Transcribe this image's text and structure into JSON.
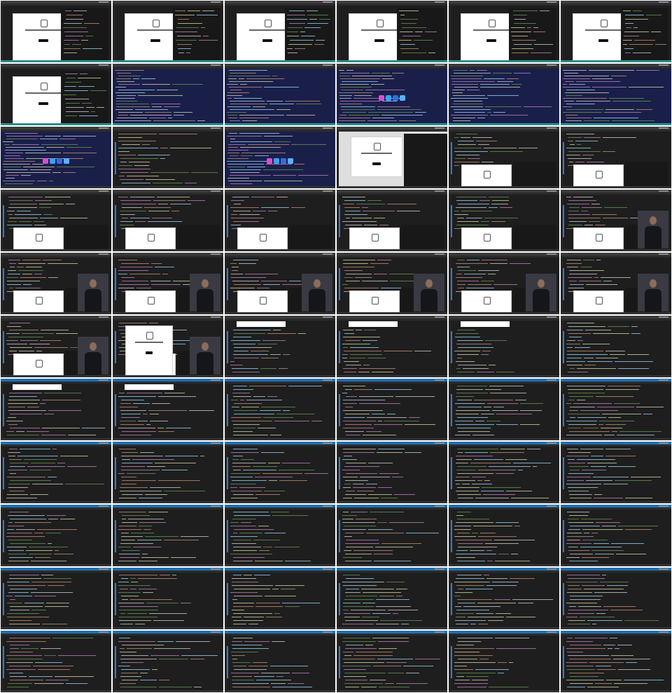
{
  "contact_sheet": {
    "columns": 6,
    "rows": 11,
    "frames": [
      {
        "variant": "dark-modal"
      },
      {
        "variant": "dark-modal"
      },
      {
        "variant": "dark-modal"
      },
      {
        "variant": "dark-modal"
      },
      {
        "variant": "dark-modal-panel"
      },
      {
        "variant": "dark-modal-panel"
      },
      {
        "variant": "dark-modal"
      },
      {
        "variant": "terminal-blue"
      },
      {
        "variant": "terminal-blue"
      },
      {
        "variant": "terminal-blue"
      },
      {
        "variant": "terminal-blue"
      },
      {
        "variant": "terminal-blue"
      },
      {
        "variant": "terminal-blue-dock"
      },
      {
        "variant": "editor-dark"
      },
      {
        "variant": "terminal-blue"
      },
      {
        "variant": "light-modal"
      },
      {
        "variant": "editor-small-modal"
      },
      {
        "variant": "editor-small-modal"
      },
      {
        "variant": "editor-small-modal"
      },
      {
        "variant": "editor-small-modal"
      },
      {
        "variant": "editor-small-modal"
      },
      {
        "variant": "editor-small-modal"
      },
      {
        "variant": "editor-small-modal"
      },
      {
        "variant": "editor-person"
      },
      {
        "variant": "editor-person"
      },
      {
        "variant": "editor-person"
      },
      {
        "variant": "editor-person"
      },
      {
        "variant": "editor-person"
      },
      {
        "variant": "editor-person"
      },
      {
        "variant": "editor-person"
      },
      {
        "variant": "editor-person"
      },
      {
        "variant": "editor-modal-person"
      },
      {
        "variant": "editor-whitebar"
      },
      {
        "variant": "editor-whitebar"
      },
      {
        "variant": "editor-whitebar"
      },
      {
        "variant": "editor-code"
      },
      {
        "variant": "editor-whitebar"
      },
      {
        "variant": "editor-whitebar"
      },
      {
        "variant": "editor-code"
      },
      {
        "variant": "editor-code"
      },
      {
        "variant": "editor-code"
      },
      {
        "variant": "editor-code"
      },
      {
        "variant": "editor-code"
      },
      {
        "variant": "editor-code"
      },
      {
        "variant": "editor-code"
      },
      {
        "variant": "editor-code"
      },
      {
        "variant": "editor-code"
      },
      {
        "variant": "editor-code"
      },
      {
        "variant": "editor-code"
      },
      {
        "variant": "editor-code"
      },
      {
        "variant": "editor-code"
      },
      {
        "variant": "editor-code"
      },
      {
        "variant": "editor-code"
      },
      {
        "variant": "editor-code"
      },
      {
        "variant": "editor-code"
      },
      {
        "variant": "editor-code"
      },
      {
        "variant": "editor-code"
      },
      {
        "variant": "editor-code"
      },
      {
        "variant": "editor-code"
      },
      {
        "variant": "editor-code"
      },
      {
        "variant": "editor-code"
      },
      {
        "variant": "editor-code"
      },
      {
        "variant": "editor-code"
      },
      {
        "variant": "editor-code"
      },
      {
        "variant": "editor-code"
      },
      {
        "variant": "editor-code"
      }
    ],
    "colors": {
      "editor_bg": "#1e1e1e",
      "terminal_bg": "#1a1f4a",
      "accent": "#2f7bd6",
      "keyword": "#c586c0",
      "string": "#ce9178",
      "text": "#d4d4d4",
      "comment": "#6a9955",
      "function": "#dcdcaa",
      "variable": "#9cdcfe"
    }
  }
}
